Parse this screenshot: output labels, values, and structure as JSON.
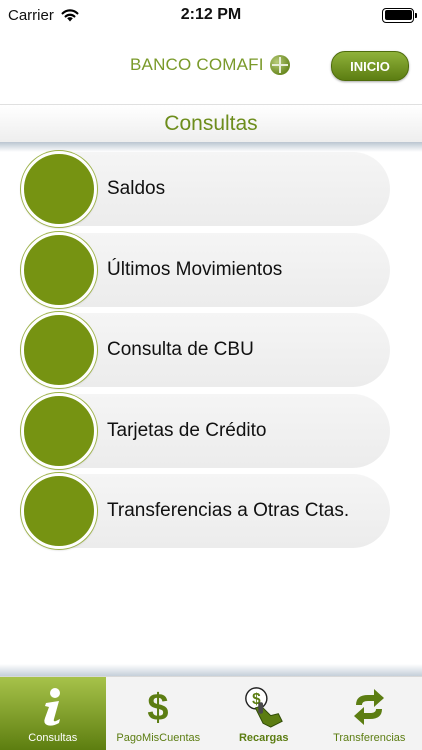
{
  "status_bar": {
    "carrier": "Carrier",
    "time": "2:12 PM"
  },
  "header": {
    "brand": "BANCO COMAFI",
    "home_button": "INICIO"
  },
  "section": {
    "title": "Consultas"
  },
  "menu": {
    "items": [
      {
        "label": "Saldos"
      },
      {
        "label": "Últimos Movimientos"
      },
      {
        "label": "Consulta de CBU"
      },
      {
        "label": "Tarjetas de Crédito"
      },
      {
        "label": "Transferencias a Otras Ctas."
      }
    ]
  },
  "tabs": [
    {
      "label": "Consultas",
      "icon": "info-icon",
      "active": true
    },
    {
      "label": "PagoMisCuentas",
      "icon": "dollar-icon",
      "active": false
    },
    {
      "label": "Recargas",
      "icon": "recharge-icon",
      "active": false
    },
    {
      "label": "Transferencias",
      "icon": "transfer-arrows-icon",
      "active": false
    }
  ],
  "colors": {
    "brand_green": "#769312",
    "title_green": "#6d8d1c"
  }
}
